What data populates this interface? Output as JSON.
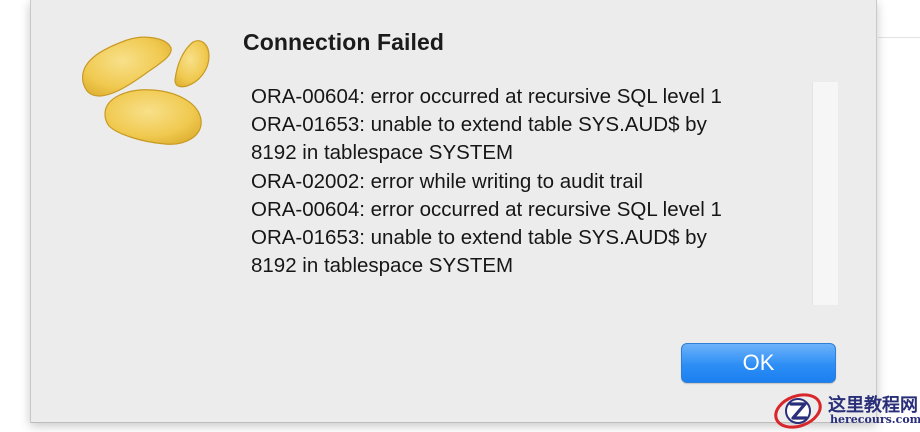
{
  "dialog": {
    "title": "Connection Failed",
    "app_icon": "navicat-logo-icon",
    "message_lines": [
      "ORA-00604: error occurred at recursive SQL level 1",
      "ORA-01653: unable to extend table SYS.AUD$ by",
      "8192 in tablespace SYSTEM",
      "ORA-02002: error while writing to audit trail",
      "ORA-00604: error occurred at recursive SQL level 1",
      "ORA-01653: unable to extend table SYS.AUD$ by",
      "8192 in tablespace SYSTEM"
    ],
    "ok_label": "OK"
  },
  "watermark": {
    "title": "这里教程网",
    "url": "herecours.com",
    "icon": "z-logo-icon"
  },
  "colors": {
    "dialog_background": "#ececec",
    "ok_button": "#2e8ef5",
    "logo_yellow": "#f2cf5a",
    "watermark_text": "#2a2f7a",
    "watermark_red": "#d8262b"
  }
}
